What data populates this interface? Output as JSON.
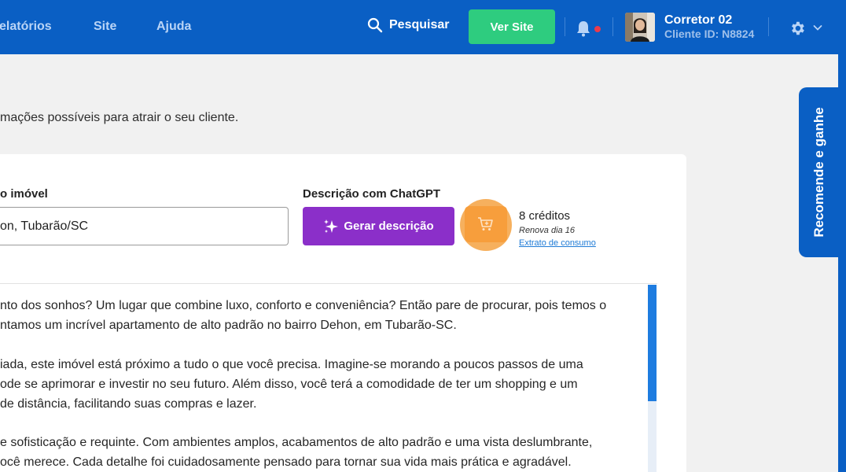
{
  "topbar": {
    "nav": [
      "elatórios",
      "Site",
      "Ajuda"
    ],
    "search_label": "Pesquisar",
    "ver_site_label": "Ver Site",
    "user_name": "Corretor 02",
    "client_id": "Cliente ID: N8824",
    "notification_dot_color": "#ea3b4c"
  },
  "page": {
    "intro": "mações possíveis para atrair o seu cliente."
  },
  "form": {
    "address_label": "o imóvel",
    "address_value": "on, Tubarão/SC",
    "gpt_label": "Descrição com ChatGPT",
    "generate_label": "Gerar descrição",
    "credits": "8 créditos",
    "renew": "Renova dia 16",
    "statement_link": "Extrato de consumo"
  },
  "description": {
    "lines": [
      "nto dos sonhos? Um lugar que combine luxo, conforto e conveniência? Então pare de procurar, pois temos o",
      "ntamos um incrível apartamento de alto padrão no bairro Dehon, em Tubarão-SC.",
      "iada, este imóvel está próximo a tudo o que você precisa. Imagine-se morando a poucos passos de uma",
      "ode se aprimorar e investir no seu futuro. Além disso, você terá a comodidade de ter um shopping e um",
      "de distância, facilitando suas compras e lazer.",
      "e sofisticação e requinte. Com ambientes amplos, acabamentos de alto padrão e uma vista deslumbrante,",
      "ocê merece. Cada detalhe foi cuidadosamente pensado para tornar sua vida mais prática e agradável."
    ]
  },
  "side_tab": {
    "label": "Recomende e ganhe"
  },
  "colors": {
    "primary": "#0a5fc4",
    "ver_site": "#2ecc7f",
    "generate": "#8b2fc9",
    "cart_highlight": "#f79e3c"
  },
  "icons": [
    "search-icon",
    "bell-icon",
    "gear-icon",
    "chevron-down-icon",
    "sparkle-icon",
    "cart-icon"
  ]
}
